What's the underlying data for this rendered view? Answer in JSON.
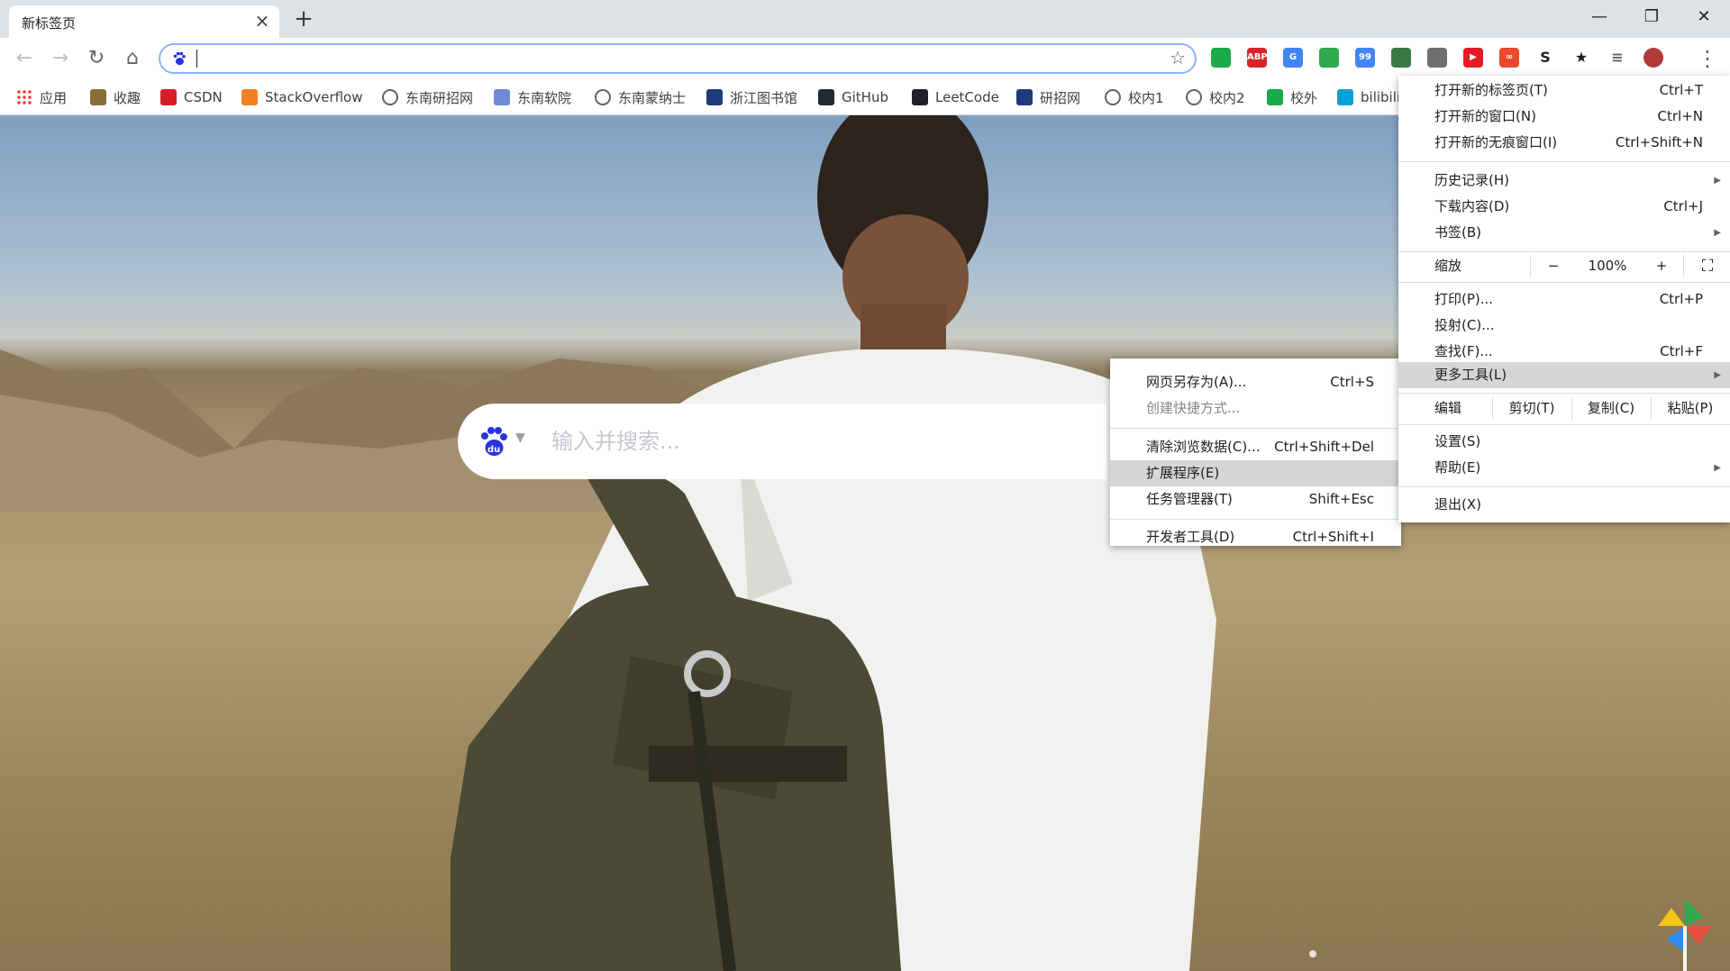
{
  "tab": {
    "title": "新标签页"
  },
  "window": {
    "minimize": "—",
    "restore": "❐",
    "close": "✕"
  },
  "omnibox": {
    "value": ""
  },
  "extensions": [
    {
      "name": "shield-extension",
      "color": "#1aaa4a",
      "text": ""
    },
    {
      "name": "adblock-plus-extension",
      "color": "#d8232a",
      "text": "ABP"
    },
    {
      "name": "translate-extension",
      "color": "#4285f4",
      "text": "G"
    },
    {
      "name": "compass-extension",
      "color": "#2fa84f",
      "text": ""
    },
    {
      "name": "badge-extension",
      "color": "#e8e8e8",
      "text": "99"
    },
    {
      "name": "map-extension",
      "color": "#3b7a45",
      "text": ""
    },
    {
      "name": "gamepad-extension",
      "color": "#6f6f6f",
      "text": ""
    },
    {
      "name": "video-extension",
      "color": "#e51b24",
      "text": "▶"
    },
    {
      "name": "infinity-extension",
      "color": "#e84a2b",
      "text": "∞"
    },
    {
      "name": "s-extension",
      "color": "#bdbdbd",
      "text": "S"
    },
    {
      "name": "star-extension",
      "color": "#202124",
      "text": "★"
    },
    {
      "name": "media-extension",
      "color": "#5f6368",
      "text": "≡"
    },
    {
      "name": "profile-avatar",
      "color": "#b33a3a",
      "text": ""
    }
  ],
  "bookmarks": [
    {
      "label": "应用",
      "icon": "apps-grid-icon",
      "color": "#ea4335"
    },
    {
      "label": "收趣",
      "icon": "shouqu-icon",
      "color": "#8a6d3b"
    },
    {
      "label": "CSDN",
      "icon": "csdn-icon",
      "color": "#d51e24"
    },
    {
      "label": "StackOverflow",
      "icon": "stackoverflow-icon",
      "color": "#f48024"
    },
    {
      "label": "东南研招网",
      "icon": "globe-icon",
      "color": "#5f6368"
    },
    {
      "label": "东南软院",
      "icon": "seu-seal-icon",
      "color": "#6b8bd6"
    },
    {
      "label": "东南蒙纳士",
      "icon": "globe-icon",
      "color": "#5f6368"
    },
    {
      "label": "浙江图书馆",
      "icon": "library-icon",
      "color": "#1d3a7a"
    },
    {
      "label": "GitHub",
      "icon": "github-icon",
      "color": "#24292e"
    },
    {
      "label": "LeetCode",
      "icon": "leetcode-icon",
      "color": "#202124"
    },
    {
      "label": "研招网",
      "icon": "graduation-cap-icon",
      "color": "#1d3a7a"
    },
    {
      "label": "校内1",
      "icon": "globe-icon",
      "color": "#5f6368"
    },
    {
      "label": "校内2",
      "icon": "globe-icon",
      "color": "#5f6368"
    },
    {
      "label": "校外",
      "icon": "shield-icon",
      "color": "#1aaa4a"
    },
    {
      "label": "bilibili",
      "icon": "bilibili-icon",
      "color": "#00a1d6"
    }
  ],
  "search": {
    "placeholder": "输入并搜索..."
  },
  "main_menu": {
    "new_tab": {
      "label": "打开新的标签页(T)",
      "shortcut": "Ctrl+T"
    },
    "new_window": {
      "label": "打开新的窗口(N)",
      "shortcut": "Ctrl+N"
    },
    "new_incognito": {
      "label": "打开新的无痕窗口(I)",
      "shortcut": "Ctrl+Shift+N"
    },
    "history": {
      "label": "历史记录(H)"
    },
    "downloads": {
      "label": "下载内容(D)",
      "shortcut": "Ctrl+J"
    },
    "bookmarks": {
      "label": "书签(B)"
    },
    "zoom": {
      "label": "缩放",
      "minus": "−",
      "value": "100%",
      "plus": "+"
    },
    "print": {
      "label": "打印(P)...",
      "shortcut": "Ctrl+P"
    },
    "cast": {
      "label": "投射(C)..."
    },
    "find": {
      "label": "查找(F)...",
      "shortcut": "Ctrl+F"
    },
    "more_tools": {
      "label": "更多工具(L)"
    },
    "edit": {
      "label": "编辑",
      "cut": "剪切(T)",
      "copy": "复制(C)",
      "paste": "粘贴(P)"
    },
    "settings": {
      "label": "设置(S)"
    },
    "help": {
      "label": "帮助(E)"
    },
    "exit": {
      "label": "退出(X)"
    }
  },
  "more_tools_menu": {
    "save_page": {
      "label": "网页另存为(A)...",
      "shortcut": "Ctrl+S"
    },
    "create_shortcut": {
      "label": "创建快捷方式..."
    },
    "clear_data": {
      "label": "清除浏览数据(C)...",
      "shortcut": "Ctrl+Shift+Del"
    },
    "extensions": {
      "label": "扩展程序(E)"
    },
    "task_manager": {
      "label": "任务管理器(T)",
      "shortcut": "Shift+Esc"
    },
    "dev_tools": {
      "label": "开发者工具(D)",
      "shortcut": "Ctrl+Shift+I"
    }
  }
}
